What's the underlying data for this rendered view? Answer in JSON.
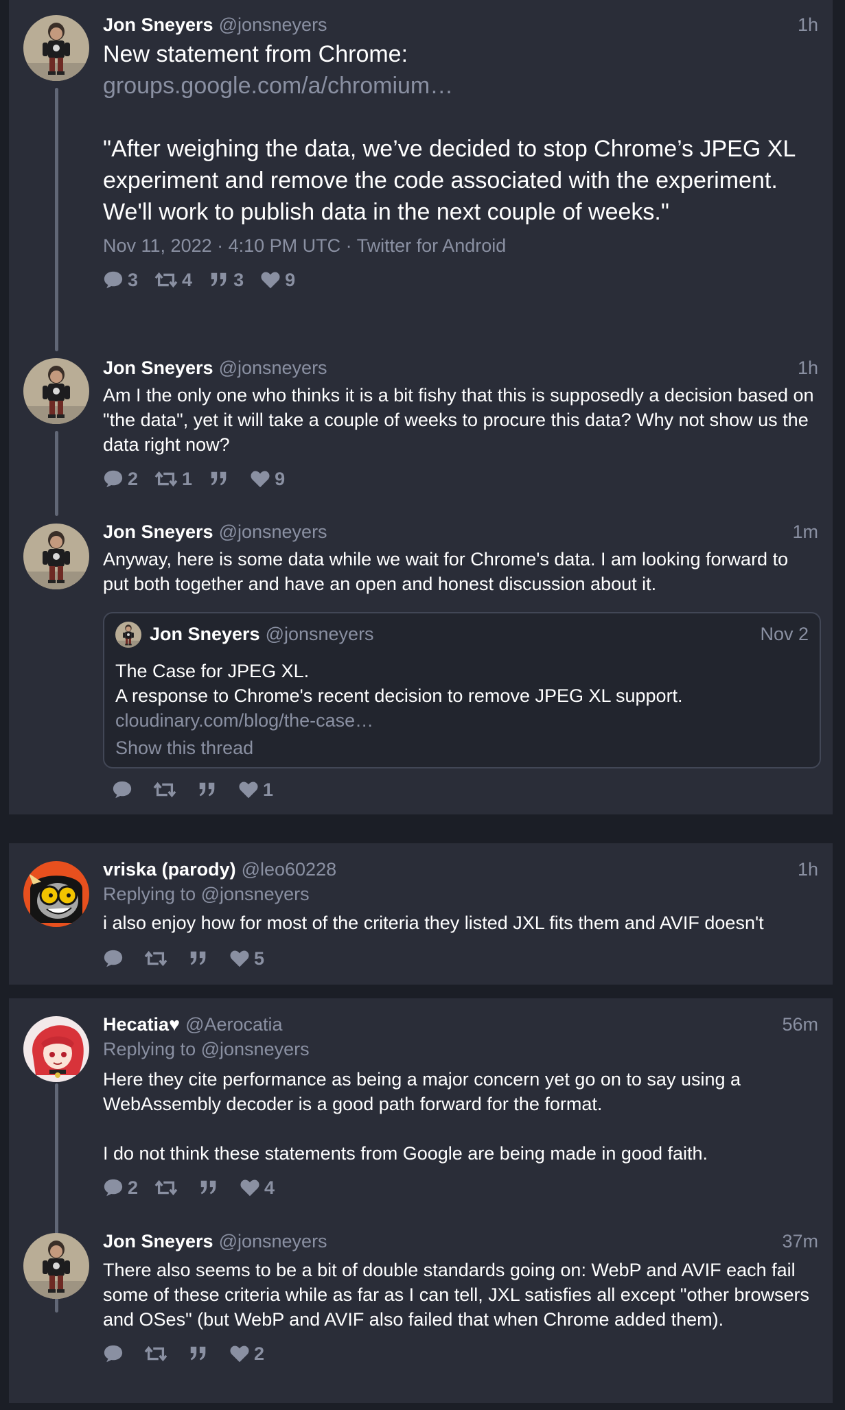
{
  "thread": {
    "tweets": [
      {
        "name": "Jon Sneyers",
        "handle": "@jonsneyers",
        "time": "1h",
        "text_line1": "New statement from Chrome:",
        "link": "groups.google.com/a/chromium…",
        "quote_text": "\"After weighing the data,  we’ve decided to stop Chrome’s JPEG XL experiment and remove the code associated with the experiment.  We'll work to publish data in the next couple of weeks.\"",
        "meta": "Nov 11, 2022 · 4:10 PM UTC · Twitter for Android",
        "replies": "3",
        "retweets": "4",
        "quotes": "3",
        "likes": "9"
      },
      {
        "name": "Jon Sneyers",
        "handle": "@jonsneyers",
        "time": "1h",
        "text": "Am I the only one who thinks it is a bit fishy that this is supposedly a decision based on \"the data\", yet it will take a couple of weeks to procure this data? Why not show us the data right now?",
        "replies": "2",
        "retweets": "1",
        "quotes": "",
        "likes": "9"
      },
      {
        "name": "Jon Sneyers",
        "handle": "@jonsneyers",
        "time": "1m",
        "text": "Anyway, here is some data while we wait for Chrome's data. I am looking forward to put both together and have an open and honest discussion about it.",
        "quoted": {
          "name": "Jon Sneyers",
          "handle": "@jonsneyers",
          "time": "Nov 2",
          "line1": "The Case for JPEG XL.",
          "line2": "A response to Chrome's recent decision to remove JPEG XL support.",
          "link": "cloudinary.com/blog/the-case…",
          "show_thread": "Show this thread"
        },
        "replies": "",
        "retweets": "",
        "quotes": "",
        "likes": "1"
      }
    ]
  },
  "reply1": {
    "name": "vriska (parody)",
    "handle": "@leo60228",
    "time": "1h",
    "replying_label": "Replying to",
    "replying_to": "@jonsneyers",
    "text": "i also enjoy how for most of the criteria they listed JXL fits them and AVIF doesn't",
    "replies": "",
    "retweets": "",
    "quotes": "",
    "likes": "5"
  },
  "thread2": {
    "tweets": [
      {
        "name": "Hecatia♥",
        "handle": "@Aerocatia",
        "time": "56m",
        "replying_label": "Replying to",
        "replying_to": "@jonsneyers",
        "text_p1": "Here they cite performance as being a major concern yet go on to say using a WebAssembly decoder is a good path forward for the format.",
        "text_p2": "I do not think these statements from Google are being made in good faith.",
        "replies": "2",
        "retweets": "",
        "quotes": "",
        "likes": "4"
      },
      {
        "name": "Jon Sneyers",
        "handle": "@jonsneyers",
        "time": "37m",
        "text": "There also seems to be a bit of double standards going on: WebP and AVIF each fail some of these criteria while as far as I can tell, JXL satisfies all except \"other browsers and OSes\" (but WebP and AVIF also failed that when Chrome added them).",
        "replies": "",
        "retweets": "",
        "quotes": "",
        "likes": "2"
      }
    ]
  },
  "colors": {
    "background": "#1b1e26",
    "card": "#2a2d38",
    "muted_text": "#8a90a2",
    "text": "#ffffff",
    "thread_line": "#616776"
  },
  "icons": {
    "reply": "comment-bubble-icon",
    "retweet": "retweet-icon",
    "quote": "quote-icon",
    "like": "heart-icon"
  }
}
